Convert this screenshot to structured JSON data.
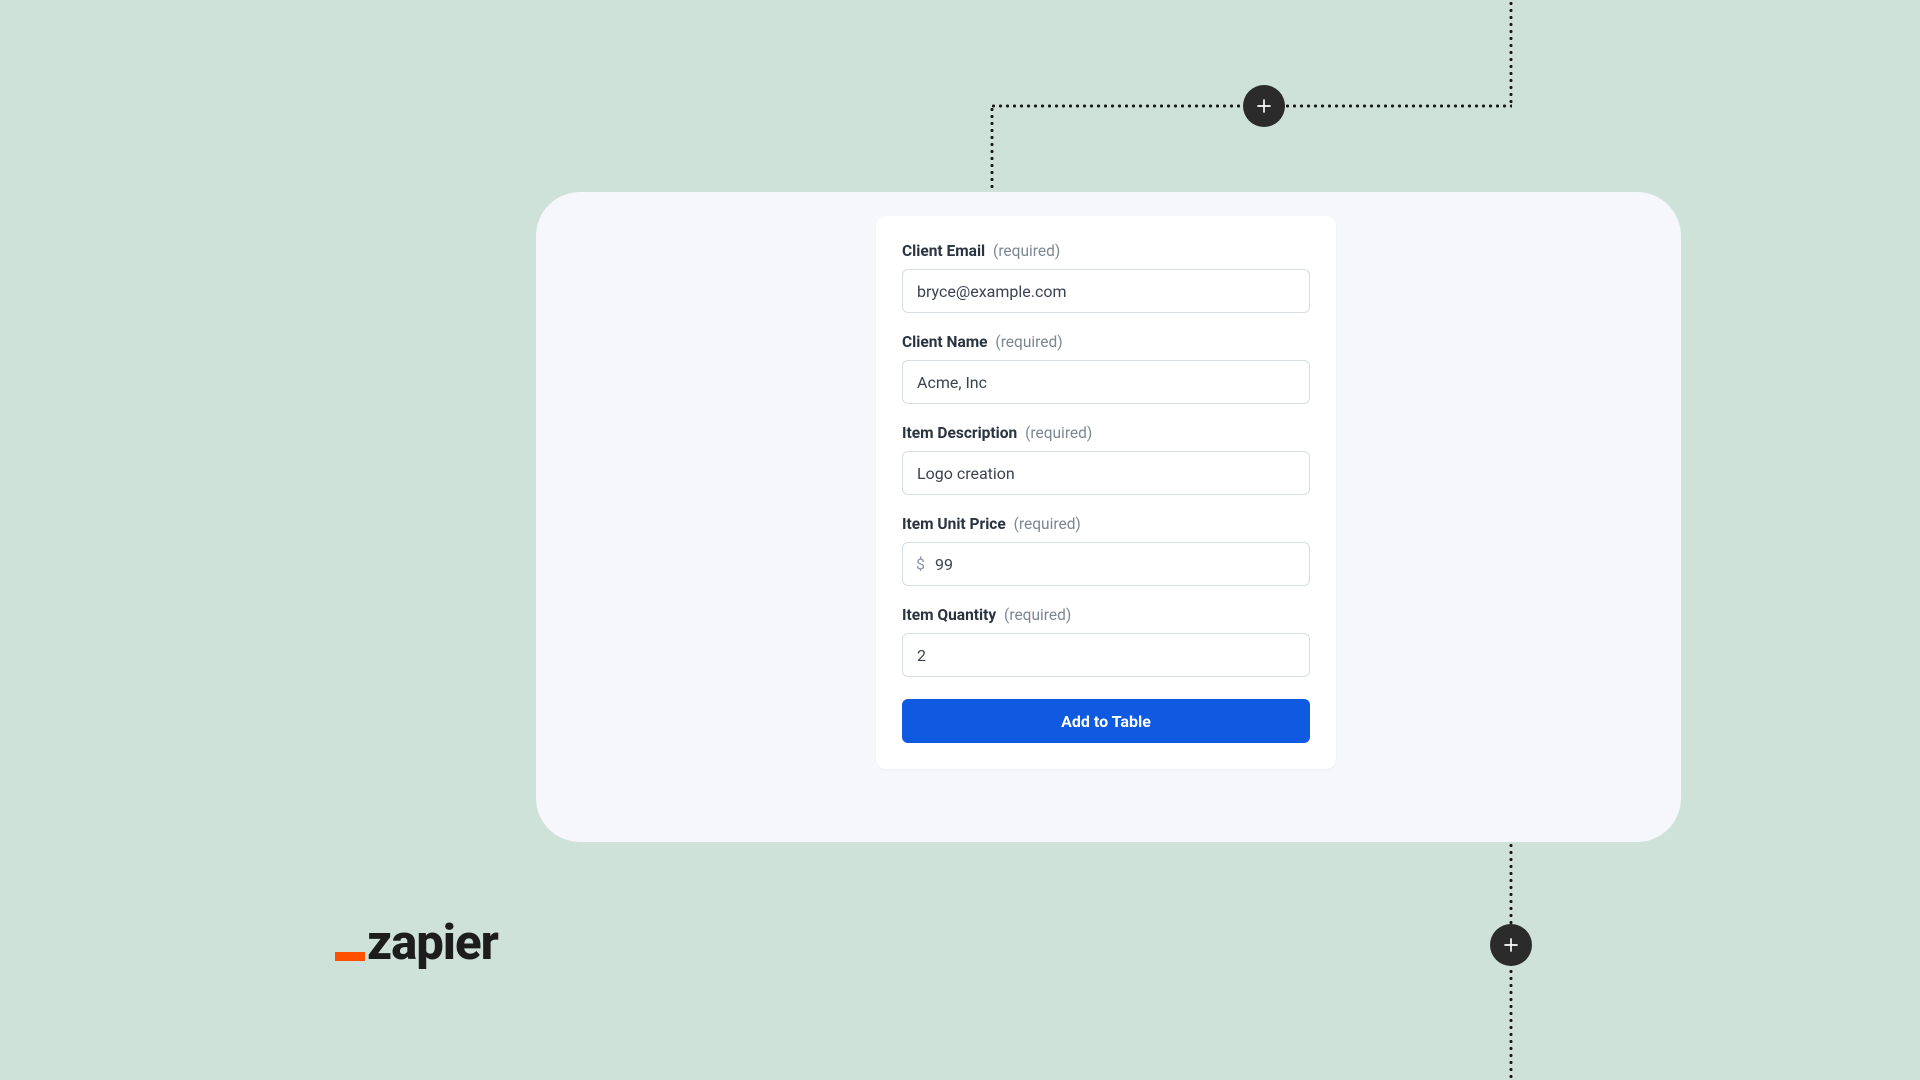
{
  "form": {
    "fields": {
      "client_email": {
        "label": "Client Email",
        "required": "(required)",
        "value": "bryce@example.com"
      },
      "client_name": {
        "label": "Client Name",
        "required": "(required)",
        "value": "Acme, Inc"
      },
      "item_description": {
        "label": "Item Description",
        "required": "(required)",
        "value": "Logo creation"
      },
      "item_unit_price": {
        "label": "Item Unit Price",
        "required": "(required)",
        "currency": "$",
        "value": "99"
      },
      "item_quantity": {
        "label": "Item Quantity",
        "required": "(required)",
        "value": "2"
      }
    },
    "submit_label": "Add to Table"
  },
  "brand": {
    "name": "zapier"
  }
}
